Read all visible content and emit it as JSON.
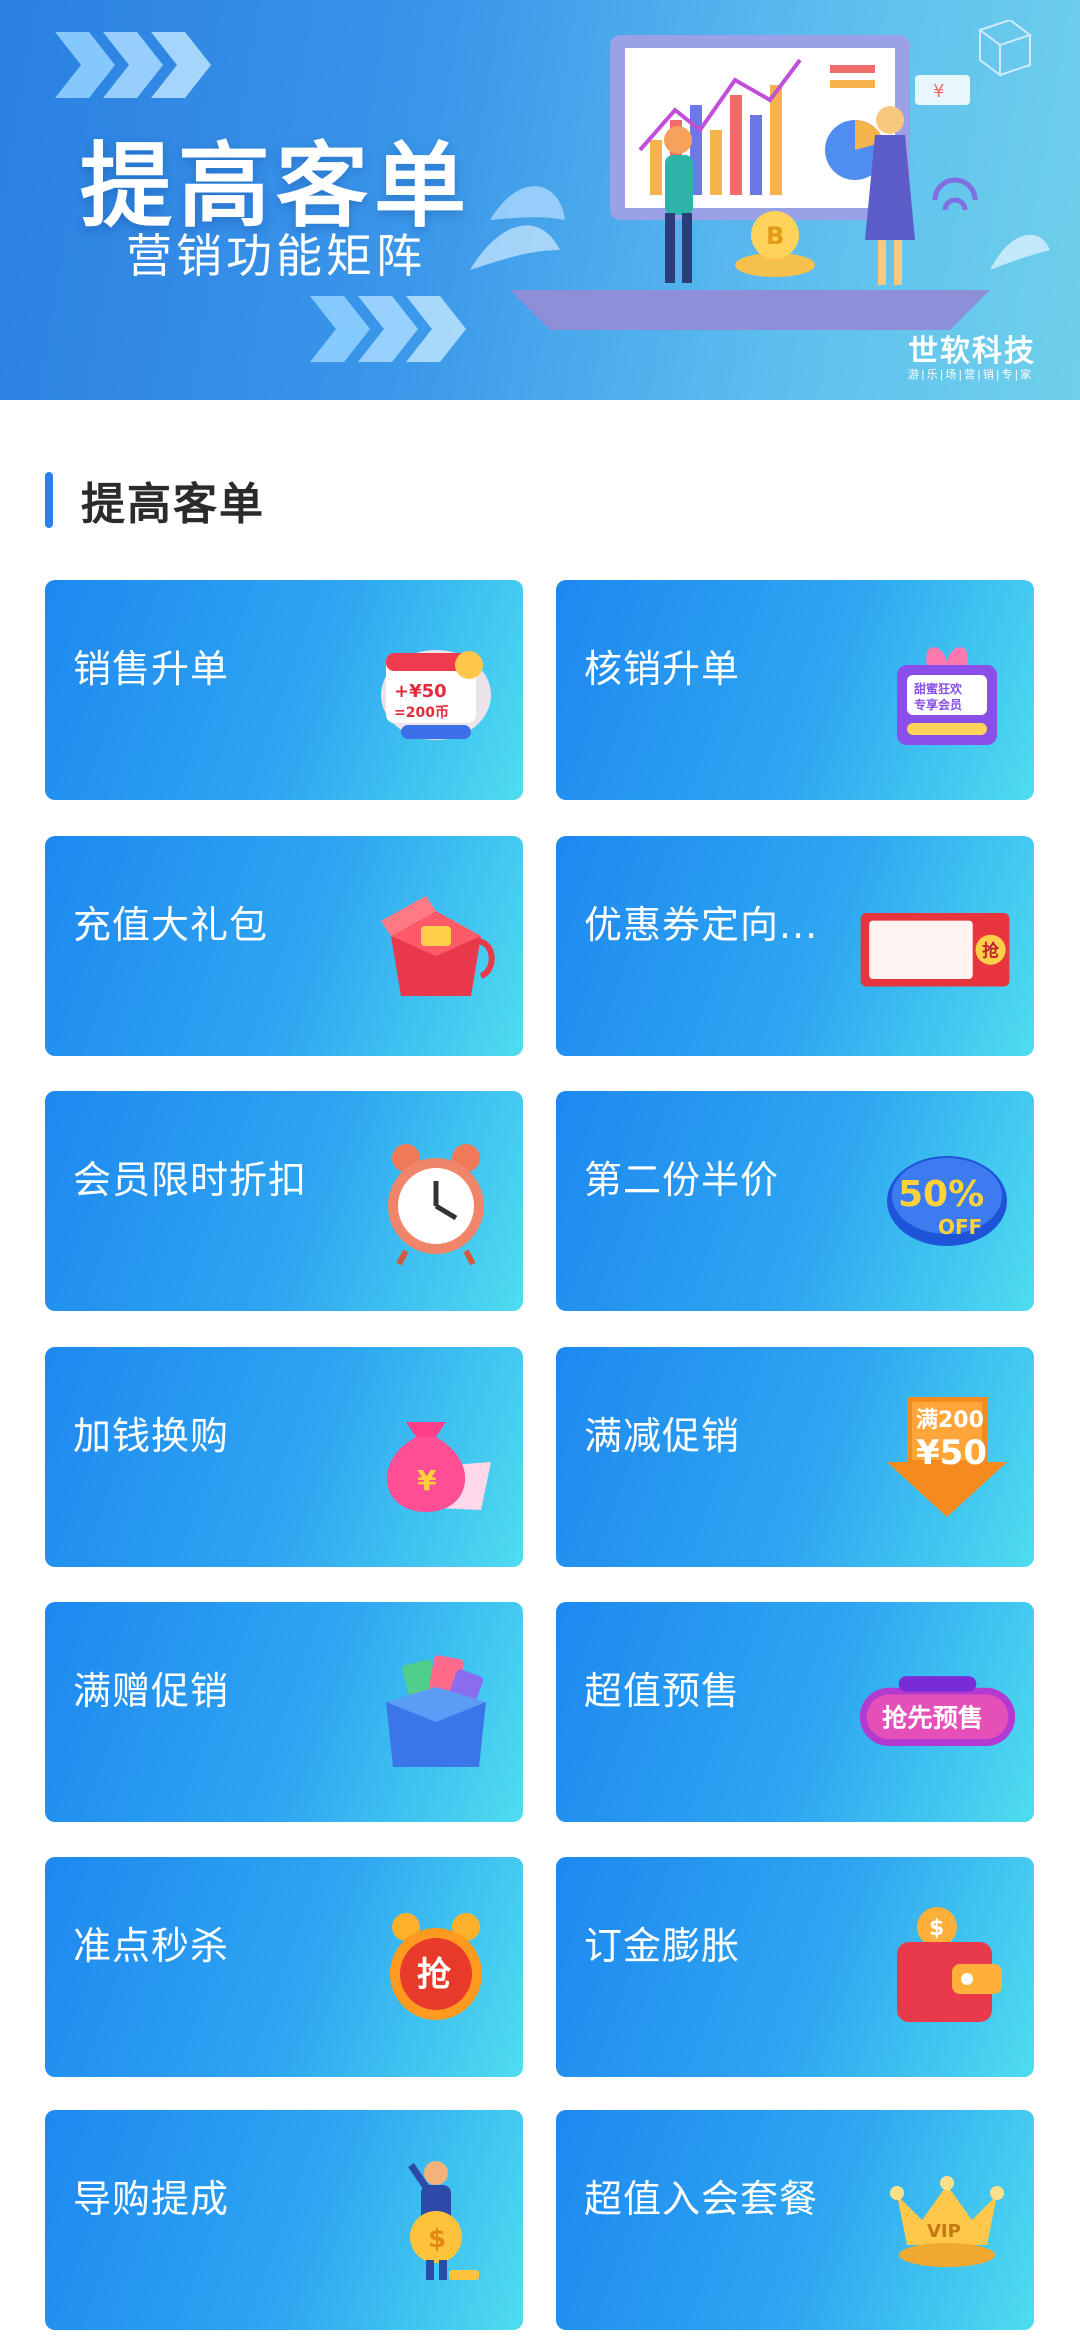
{
  "banner": {
    "title": "提高客单",
    "subtitle": "营销功能矩阵",
    "brand_name": "世软科技",
    "brand_tagline": "游|乐|场|营|销|专|家"
  },
  "section": {
    "title": "提高客单"
  },
  "features": [
    {
      "label": "销售升单",
      "icon": "coin-coupon-icon",
      "icon_text": "+¥50 =200币"
    },
    {
      "label": "核销升单",
      "icon": "gift-badge-icon",
      "icon_text": "甜蜜狂欢 专享会员"
    },
    {
      "label": "充值大礼包",
      "icon": "gift-box-icon",
      "icon_text": ""
    },
    {
      "label": "优惠券定向...",
      "icon": "coupon-ticket-icon",
      "icon_text": "抢"
    },
    {
      "label": "会员限时折扣",
      "icon": "alarm-clock-icon",
      "icon_text": ""
    },
    {
      "label": "第二份半价",
      "icon": "fifty-off-icon",
      "icon_text": "50% OFF"
    },
    {
      "label": "加钱换购",
      "icon": "money-bag-icon",
      "icon_text": "¥"
    },
    {
      "label": "满减促销",
      "icon": "discount-arrow-icon",
      "icon_text": "满200 ¥50"
    },
    {
      "label": "满赠促销",
      "icon": "open-box-icon",
      "icon_text": ""
    },
    {
      "label": "超值预售",
      "icon": "presale-badge-icon",
      "icon_text": "抢先预售"
    },
    {
      "label": "准点秒杀",
      "icon": "flash-sale-clock-icon",
      "icon_text": "抢"
    },
    {
      "label": "订金膨胀",
      "icon": "wallet-icon",
      "icon_text": "$"
    },
    {
      "label": "导购提成",
      "icon": "salesperson-coin-icon",
      "icon_text": "$"
    },
    {
      "label": "超值入会套餐",
      "icon": "vip-crown-icon",
      "icon_text": "VIP"
    }
  ],
  "colors": {
    "card_start": "#1e88f0",
    "card_end": "#4fdcef",
    "section_bar": "#2c7ff0"
  }
}
